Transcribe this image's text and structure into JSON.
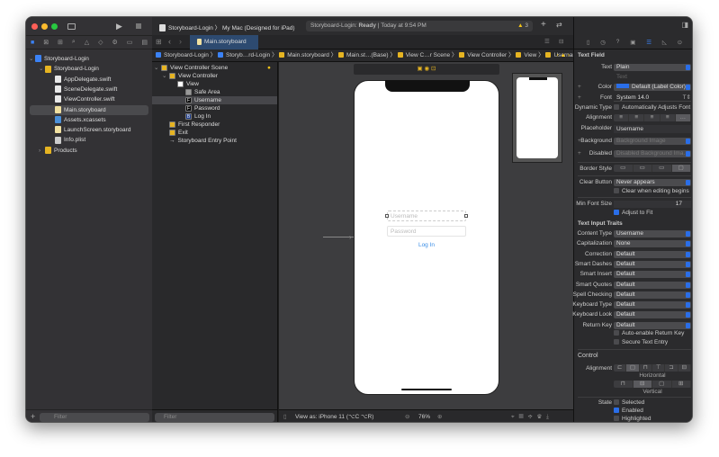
{
  "toolbar": {
    "scheme": "Storyboard-Login",
    "destination": "My Mac (Designed for iPad)",
    "status_project": "Storyboard-Login:",
    "status_state": "Ready",
    "status_time": "Today at 9:54 PM",
    "warnings": "3"
  },
  "tab": {
    "label": "Main.storyboard"
  },
  "jumpbar": [
    "Storyboard-Login",
    "Storyb…rd-Login",
    "Main.storyboard",
    "Main.st…(Base)",
    "View C…r Scene",
    "View Controller",
    "View",
    "Username"
  ],
  "navigator": {
    "items": [
      {
        "label": "Storyboard-Login",
        "level": 0,
        "icon": "project",
        "color": "#3b82f6"
      },
      {
        "label": "Storyboard-Login",
        "level": 1,
        "icon": "folder",
        "color": "#e6b422"
      },
      {
        "label": "AppDelegate.swift",
        "level": 2,
        "icon": "swift",
        "color": "#e8e8e8"
      },
      {
        "label": "SceneDelegate.swift",
        "level": 2,
        "icon": "swift",
        "color": "#e8e8e8"
      },
      {
        "label": "ViewController.swift",
        "level": 2,
        "icon": "swift",
        "color": "#e8e8e8"
      },
      {
        "label": "Main.storyboard",
        "level": 2,
        "icon": "storyboard",
        "color": "#f0e0a0",
        "selected": true
      },
      {
        "label": "Assets.xcassets",
        "level": 2,
        "icon": "assets",
        "color": "#4a90d9"
      },
      {
        "label": "LaunchScreen.storyboard",
        "level": 2,
        "icon": "storyboard",
        "color": "#f0e0a0"
      },
      {
        "label": "Info.plist",
        "level": 2,
        "icon": "plist",
        "color": "#ccc"
      },
      {
        "label": "Products",
        "level": 1,
        "icon": "folder",
        "color": "#e6b422"
      }
    ],
    "filter_placeholder": "Filter"
  },
  "outline": {
    "items": [
      {
        "label": "View Controller Scene",
        "level": 0,
        "color": "#e6b422"
      },
      {
        "label": "View Controller",
        "level": 1,
        "color": "#e6b422"
      },
      {
        "label": "View",
        "level": 2,
        "color": "#fff"
      },
      {
        "label": "Safe Area",
        "level": 3,
        "color": "#999"
      },
      {
        "label": "Username",
        "level": 3,
        "color": "#000",
        "glyph": "F",
        "selected": true
      },
      {
        "label": "Password",
        "level": 3,
        "color": "#000",
        "glyph": "F"
      },
      {
        "label": "Log In",
        "level": 3,
        "color": "#1a3a8a",
        "glyph": "B"
      },
      {
        "label": "First Responder",
        "level": 1,
        "color": "#e6b422"
      },
      {
        "label": "Exit",
        "level": 1,
        "color": "#e6b422"
      },
      {
        "label": "Storyboard Entry Point",
        "level": 1,
        "color": "none",
        "glyph": "→"
      }
    ],
    "filter_placeholder": "Filter"
  },
  "canvas": {
    "username_placeholder": "Username",
    "password_placeholder": "Password",
    "login_label": "Log In",
    "view_as": "View as: iPhone 11 (⌥C ⌥R)",
    "zoom": "76%"
  },
  "inspector": {
    "section_title": "Text Field",
    "text_label": "Text",
    "text_value": "Plain",
    "text_placeholder": "Text",
    "color_label": "Color",
    "color_value": "Default (Label Color)",
    "font_label": "Font",
    "font_value": "System 14.0",
    "dynamic_type_label": "Dynamic Type",
    "dynamic_type_value": "Automatically Adjusts Font",
    "alignment_label": "Alignment",
    "placeholder_label": "Placeholder",
    "placeholder_value": "Username",
    "background_label": "Background",
    "background_value": "Background Image",
    "disabled_label": "Disabled",
    "disabled_value": "Disabled Background Ima…",
    "border_style_label": "Border Style",
    "clear_button_label": "Clear Button",
    "clear_button_value": "Never appears",
    "clear_editing": "Clear when editing begins",
    "min_font_label": "Min Font Size",
    "min_font_value": "17",
    "adjust_fit": "Adjust to Fit",
    "traits_title": "Text Input Traits",
    "traits": [
      {
        "label": "Content Type",
        "value": "Username"
      },
      {
        "label": "Capitalization",
        "value": "None"
      },
      {
        "label": "Correction",
        "value": "Default"
      },
      {
        "label": "Smart Dashes",
        "value": "Default"
      },
      {
        "label": "Smart Insert",
        "value": "Default"
      },
      {
        "label": "Smart Quotes",
        "value": "Default"
      },
      {
        "label": "Spell Checking",
        "value": "Default"
      },
      {
        "label": "Keyboard Type",
        "value": "Default"
      },
      {
        "label": "Keyboard Look",
        "value": "Default"
      },
      {
        "label": "Return Key",
        "value": "Default"
      }
    ],
    "auto_return": "Auto-enable Return Key",
    "secure": "Secure Text Entry",
    "control_title": "Control",
    "control_alignment_label": "Alignment",
    "horizontal": "Horizontal",
    "vertical": "Vertical",
    "state_label": "State",
    "selected": "Selected",
    "enabled": "Enabled",
    "highlighted": "Highlighted"
  }
}
